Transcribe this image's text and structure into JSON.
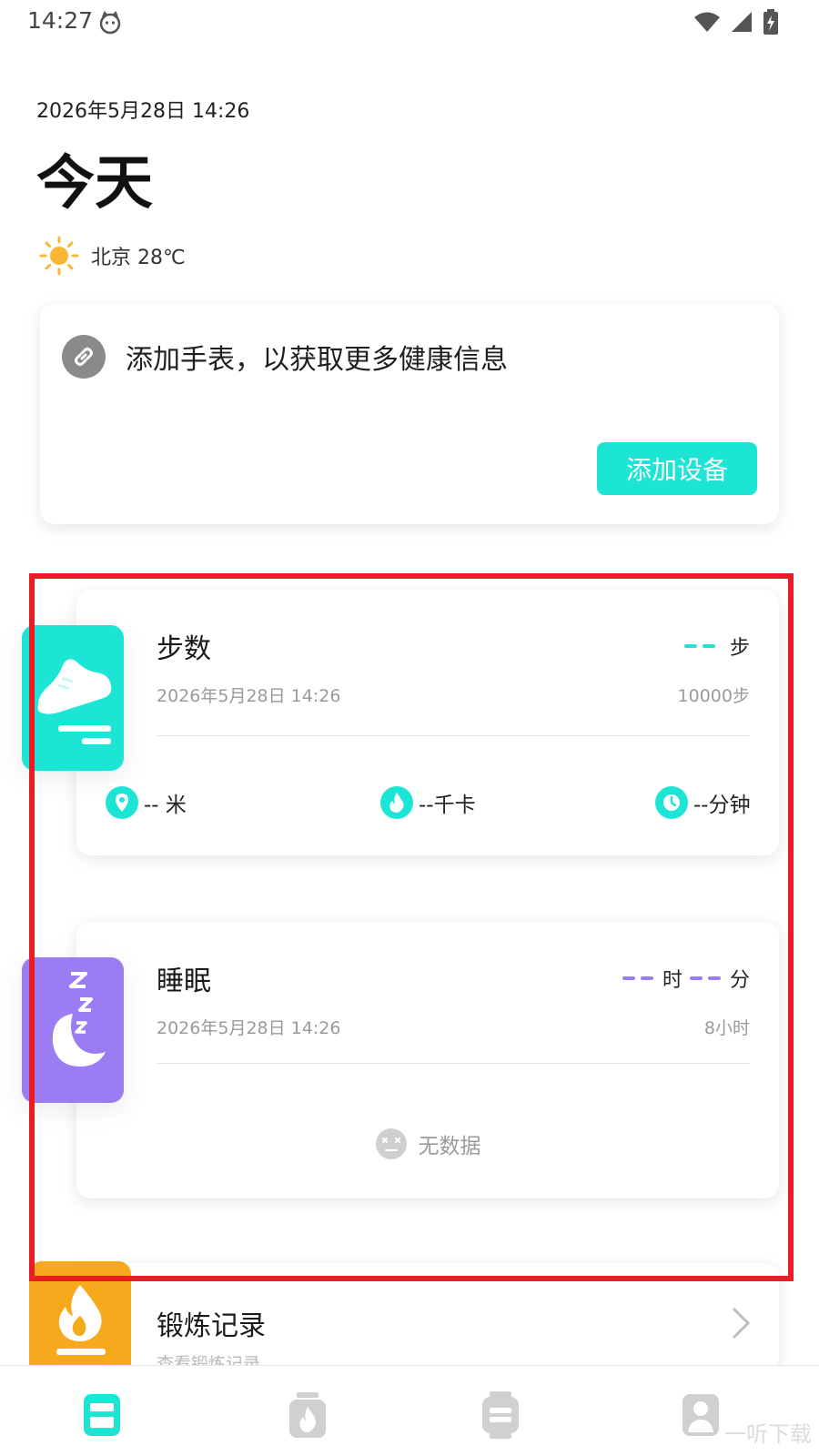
{
  "status_bar": {
    "time": "14:27"
  },
  "header": {
    "datetime": "2026年5月28日 14:26",
    "title": "今天",
    "weather": "北京 28℃"
  },
  "add_device": {
    "message": "添加手表，以获取更多健康信息",
    "button_label": "添加设备"
  },
  "steps": {
    "title": "步数",
    "date": "2026年5月28日 14:26",
    "unit": "步",
    "goal": "10000步",
    "metrics": [
      {
        "label": "-- 米"
      },
      {
        "label": "--千卡"
      },
      {
        "label": "--分钟"
      }
    ]
  },
  "sleep": {
    "title": "睡眠",
    "date": "2026年5月28日 14:26",
    "hour_unit": "时",
    "minute_unit": "分",
    "goal": "8小时",
    "no_data": "无数据"
  },
  "exercise": {
    "title": "锻炼记录",
    "subtitle": "查看锻炼记录"
  },
  "watermark": "一听下载",
  "colors": {
    "teal": "#1de5d6",
    "purple": "#9c7cf2",
    "orange": "#f7a91e",
    "highlight": "#ec1c24"
  }
}
